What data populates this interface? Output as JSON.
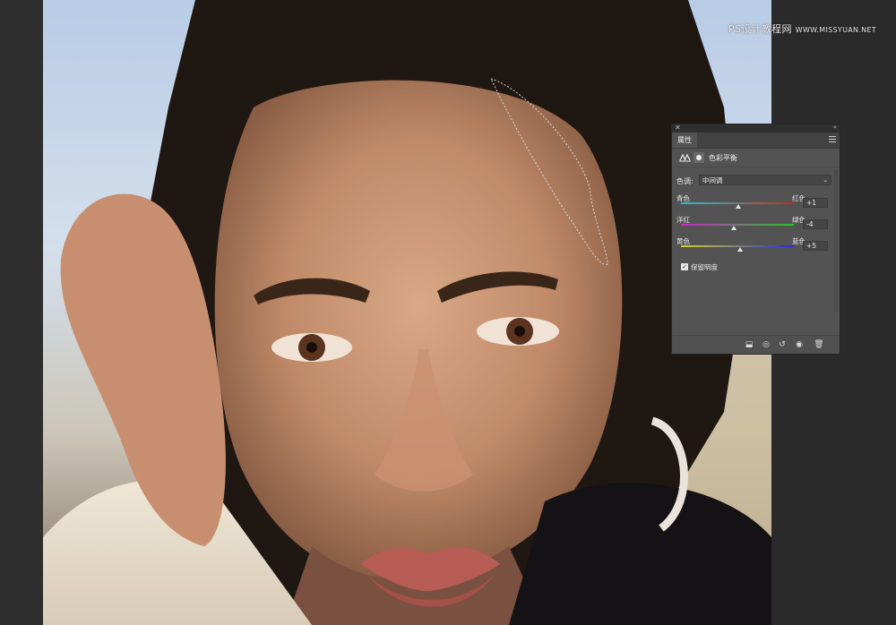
{
  "watermark": {
    "text": "PS设计教程网",
    "url": "WWW.MISSYUAN.NET"
  },
  "panel": {
    "tab_label": "属性",
    "adjustment_name": "色彩平衡",
    "tone_label": "色调:",
    "tone_value": "中间调",
    "sliders": [
      {
        "left": "青色",
        "right": "红色",
        "value": "+1",
        "level": 0.51,
        "gradient": [
          "#25c6c6",
          "#c62a2a"
        ]
      },
      {
        "left": "洋红",
        "right": "绿色",
        "value": "-4",
        "level": 0.47,
        "gradient": [
          "#c42ac4",
          "#2ac42a"
        ]
      },
      {
        "left": "黄色",
        "right": "蓝色",
        "value": "+5",
        "level": 0.52,
        "gradient": [
          "#d4d42a",
          "#2a2ad4"
        ]
      }
    ],
    "preserve_luminosity": {
      "label": "保留明度",
      "checked": true
    },
    "footer_icons": [
      "clip-to-layer-icon",
      "view-previous-icon",
      "reset-icon",
      "visibility-icon",
      "trash-icon"
    ]
  },
  "colors": {
    "pasteboard": "#2b2b2b",
    "panel_bg": "#535353",
    "panel_dark": "#2f2f2f"
  }
}
